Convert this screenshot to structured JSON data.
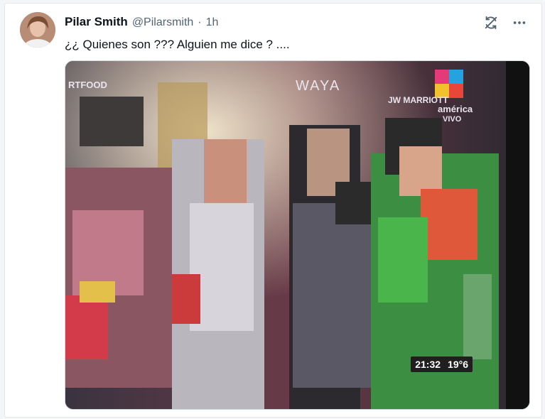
{
  "tweet": {
    "author_name": "Pilar Smith",
    "handle": "@Pilarsmith",
    "separator": "·",
    "time": "1h",
    "text": "¿¿ Quienes son ??? Alguien me dice ? ....",
    "icons": {
      "share": "sync-icon",
      "more": "more-dots-icon"
    }
  },
  "media": {
    "overlay_brand_left": "RTFOOD",
    "overlay_brand_center": "WAYA",
    "overlay_brand_jw": "JW MARRIOTT",
    "overlay_channel_name": "américa",
    "overlay_channel_status": "VIVO",
    "overlay_clock_time": "21:32",
    "overlay_clock_temp": "19°6"
  },
  "colors": {
    "text_primary": "#0f1419",
    "text_secondary": "#536471",
    "card_bg": "#ffffff",
    "page_bg": "#f4f5f7"
  }
}
